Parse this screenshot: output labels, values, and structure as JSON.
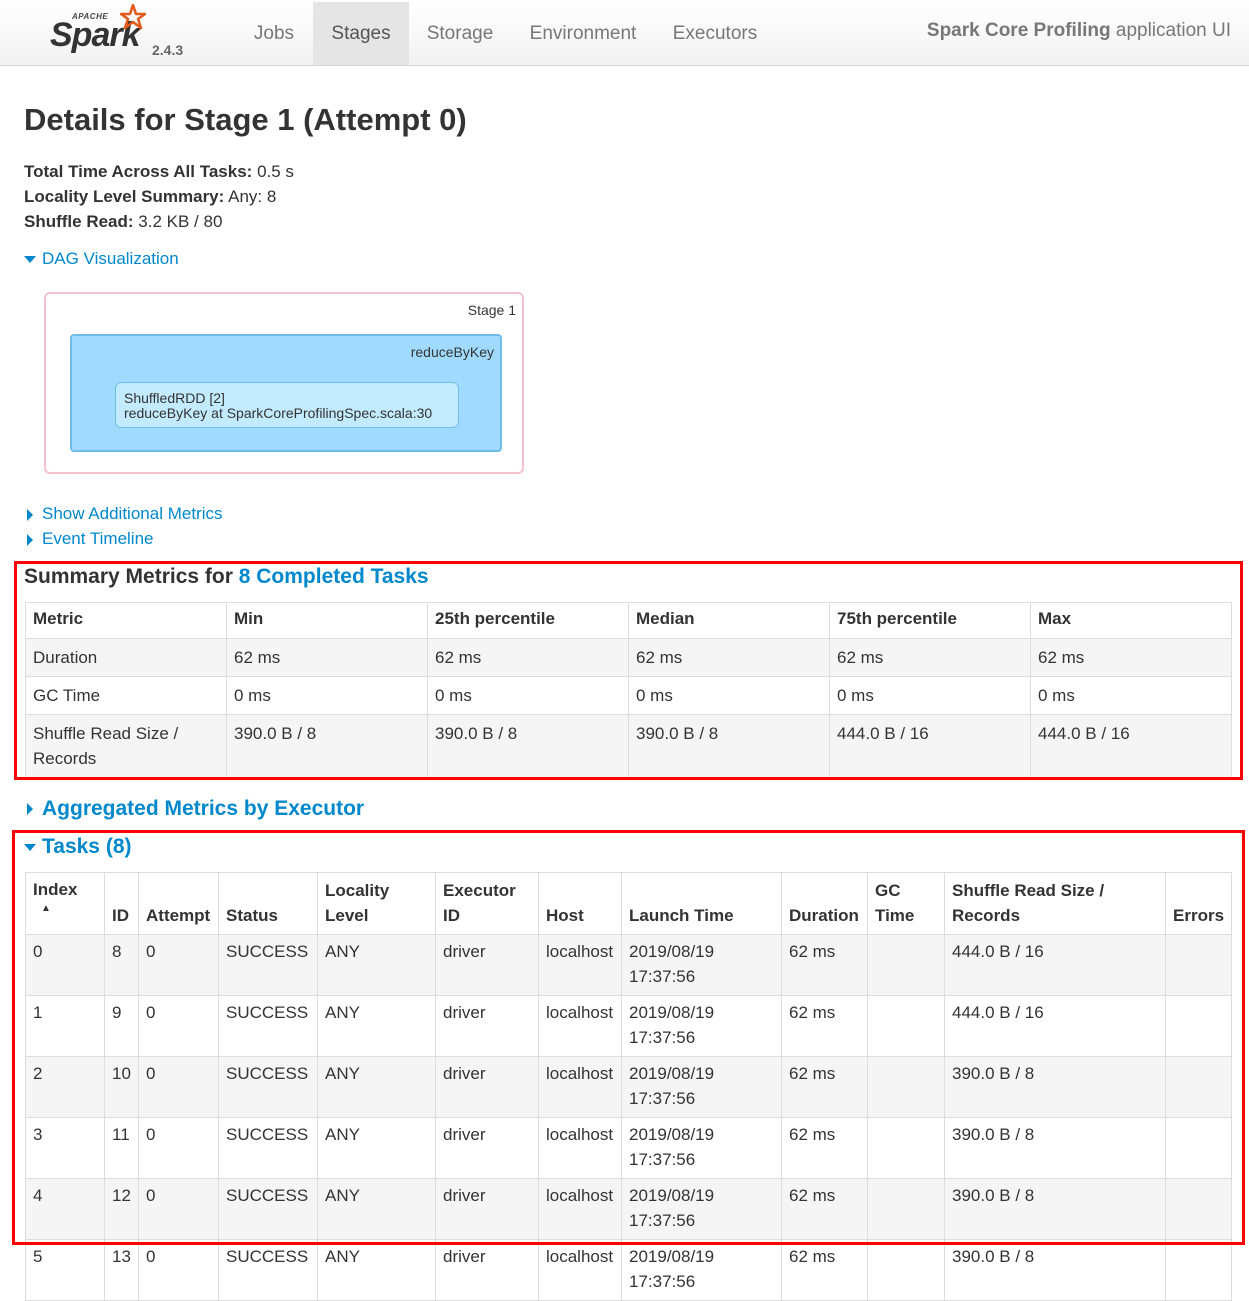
{
  "nav": {
    "brand_apache": "APACHE",
    "brand_name": "Spark",
    "version": "2.4.3",
    "tabs": [
      {
        "label": "Jobs"
      },
      {
        "label": "Stages"
      },
      {
        "label": "Storage"
      },
      {
        "label": "Environment"
      },
      {
        "label": "Executors"
      }
    ],
    "app_name": "Spark Core Profiling",
    "app_suffix": "application UI"
  },
  "page": {
    "title": "Details for Stage 1 (Attempt 0)",
    "summary": [
      {
        "label": "Total Time Across All Tasks:",
        "value": "0.5 s"
      },
      {
        "label": "Locality Level Summary:",
        "value": "Any: 8"
      },
      {
        "label": "Shuffle Read:",
        "value": "3.2 KB / 80"
      }
    ],
    "dag_toggle": "DAG Visualization",
    "additional_metrics": "Show Additional Metrics",
    "event_timeline": "Event Timeline"
  },
  "dag": {
    "stage_label": "Stage 1",
    "cluster_label": "reduceByKey",
    "node_line1": "ShuffledRDD [2]",
    "node_line2": "reduceByKey at SparkCoreProfilingSpec.scala:30"
  },
  "summary_metrics": {
    "heading_prefix": "Summary Metrics for",
    "heading_link": "8 Completed Tasks",
    "columns": [
      "Metric",
      "Min",
      "25th percentile",
      "Median",
      "75th percentile",
      "Max"
    ],
    "rows": [
      [
        "Duration",
        "62 ms",
        "62 ms",
        "62 ms",
        "62 ms",
        "62 ms"
      ],
      [
        "GC Time",
        "0 ms",
        "0 ms",
        "0 ms",
        "0 ms",
        "0 ms"
      ],
      [
        "Shuffle Read Size / Records",
        "390.0 B / 8",
        "390.0 B / 8",
        "390.0 B / 8",
        "444.0 B / 16",
        "444.0 B / 16"
      ]
    ]
  },
  "aggregated": {
    "heading": "Aggregated Metrics by Executor"
  },
  "tasks": {
    "heading": "Tasks (8)",
    "sort_indicator": "▲",
    "columns": [
      "Index",
      "ID",
      "Attempt",
      "Status",
      "Locality Level",
      "Executor ID",
      "Host",
      "Launch Time",
      "Duration",
      "GC Time",
      "Shuffle Read Size / Records",
      "Errors"
    ],
    "rows": [
      [
        "0",
        "8",
        "0",
        "SUCCESS",
        "ANY",
        "driver",
        "localhost",
        "2019/08/19 17:37:56",
        "62 ms",
        "",
        "444.0 B / 16",
        ""
      ],
      [
        "1",
        "9",
        "0",
        "SUCCESS",
        "ANY",
        "driver",
        "localhost",
        "2019/08/19 17:37:56",
        "62 ms",
        "",
        "444.0 B / 16",
        ""
      ],
      [
        "2",
        "10",
        "0",
        "SUCCESS",
        "ANY",
        "driver",
        "localhost",
        "2019/08/19 17:37:56",
        "62 ms",
        "",
        "390.0 B / 8",
        ""
      ],
      [
        "3",
        "11",
        "0",
        "SUCCESS",
        "ANY",
        "driver",
        "localhost",
        "2019/08/19 17:37:56",
        "62 ms",
        "",
        "390.0 B / 8",
        ""
      ],
      [
        "4",
        "12",
        "0",
        "SUCCESS",
        "ANY",
        "driver",
        "localhost",
        "2019/08/19 17:37:56",
        "62 ms",
        "",
        "390.0 B / 8",
        ""
      ],
      [
        "5",
        "13",
        "0",
        "SUCCESS",
        "ANY",
        "driver",
        "localhost",
        "2019/08/19 17:37:56",
        "62 ms",
        "",
        "390.0 B / 8",
        ""
      ]
    ]
  },
  "colors": {
    "link": "#0088cc",
    "highlight_box": "#ff0000",
    "dag_cluster": "#a0dbff",
    "dag_stage_border": "#f5c1cc"
  }
}
